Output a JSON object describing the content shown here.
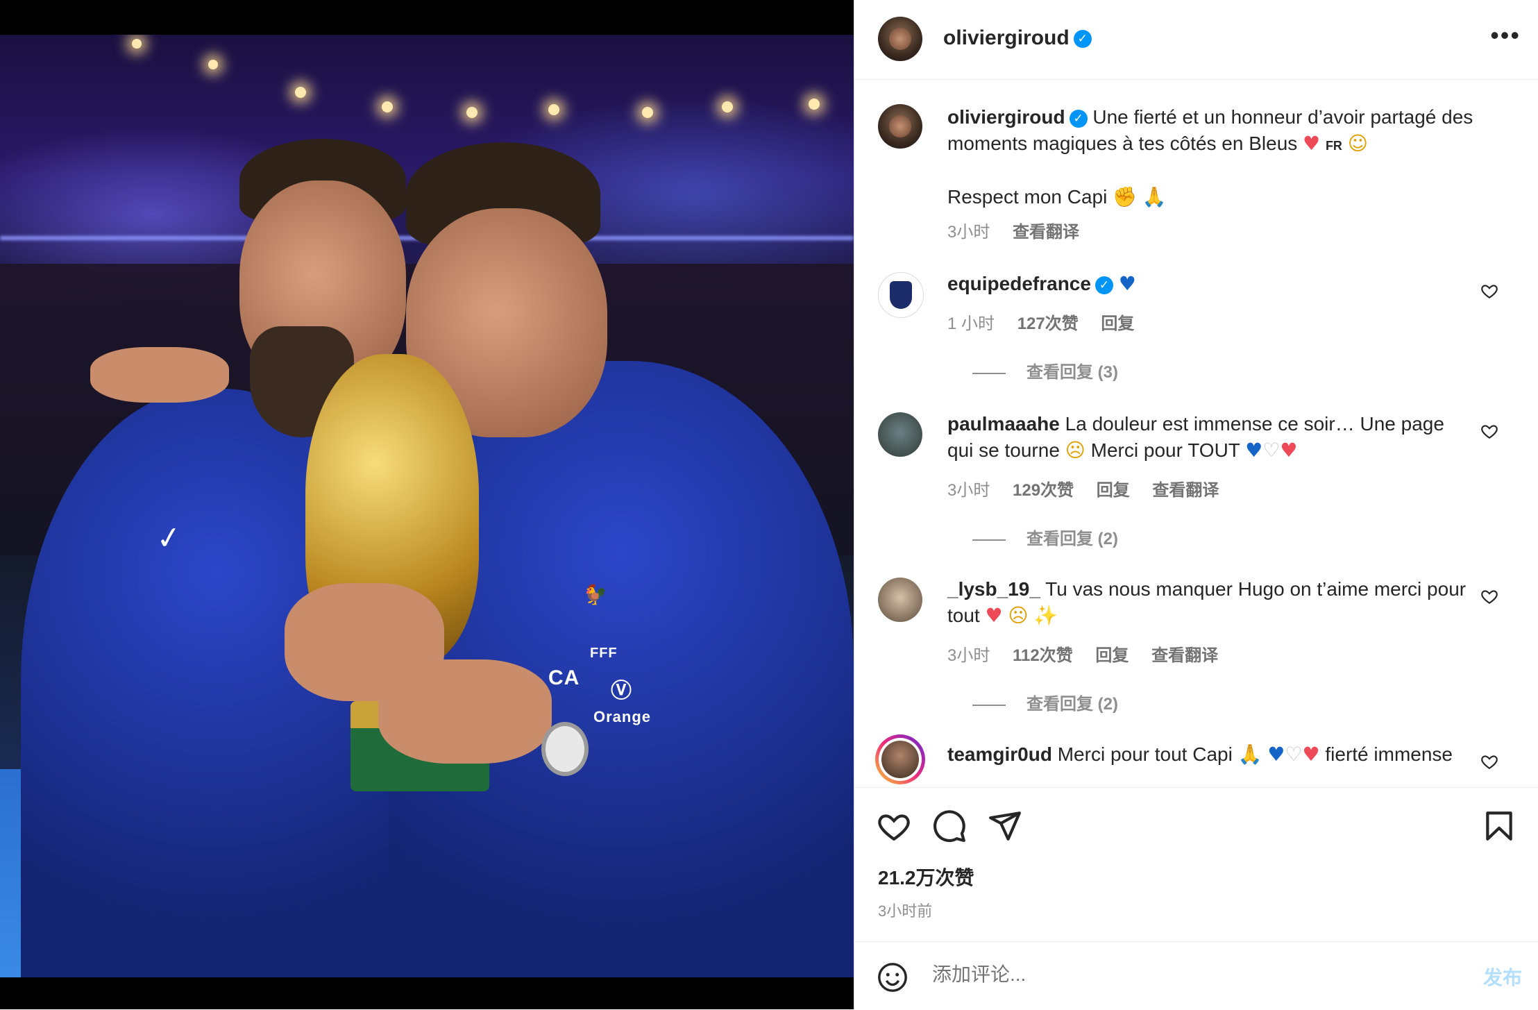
{
  "post": {
    "username": "oliviergiroud",
    "caption_line1": "Une fierté et un honneur d’avoir partagé des moments magiques à tes côtés en Bleus",
    "caption_flag": "FR",
    "caption_line2": "Respect mon Capi",
    "time": "3小时",
    "translate": "查看翻译"
  },
  "comments": [
    {
      "username": "equipedefrance",
      "text": "",
      "time": "1 小时",
      "likes": "127次赞",
      "reply": "回复",
      "translate": "",
      "view_replies": "查看回复 (3)"
    },
    {
      "username": "paulmaaahe",
      "text": "La douleur est immense ce soir… Une page qui se tourne",
      "text2": "Merci pour TOUT",
      "time": "3小时",
      "likes": "129次赞",
      "reply": "回复",
      "translate": "查看翻译",
      "view_replies": "查看回复 (2)"
    },
    {
      "username": "_lysb_19_",
      "text": "Tu vas nous manquer Hugo on t’aime merci pour tout",
      "time": "3小时",
      "likes": "112次赞",
      "reply": "回复",
      "translate": "查看翻译",
      "view_replies": "查看回复 (2)"
    },
    {
      "username": "teamgir0ud",
      "text": "Merci pour tout Capi",
      "text2": "fierté immense"
    }
  ],
  "actions": {
    "likes": "21.2万次赞",
    "ago": "3小时前"
  },
  "compose": {
    "placeholder": "添加评论...",
    "post_label": "发布"
  },
  "colors": {
    "accent": "#0095f6",
    "like": "#ed4956",
    "muted": "#8e8e8e"
  },
  "icons": [
    "more-icon",
    "heart-icon",
    "comment-icon",
    "share-icon",
    "bookmark-icon",
    "emoji-icon",
    "verified-icon"
  ]
}
